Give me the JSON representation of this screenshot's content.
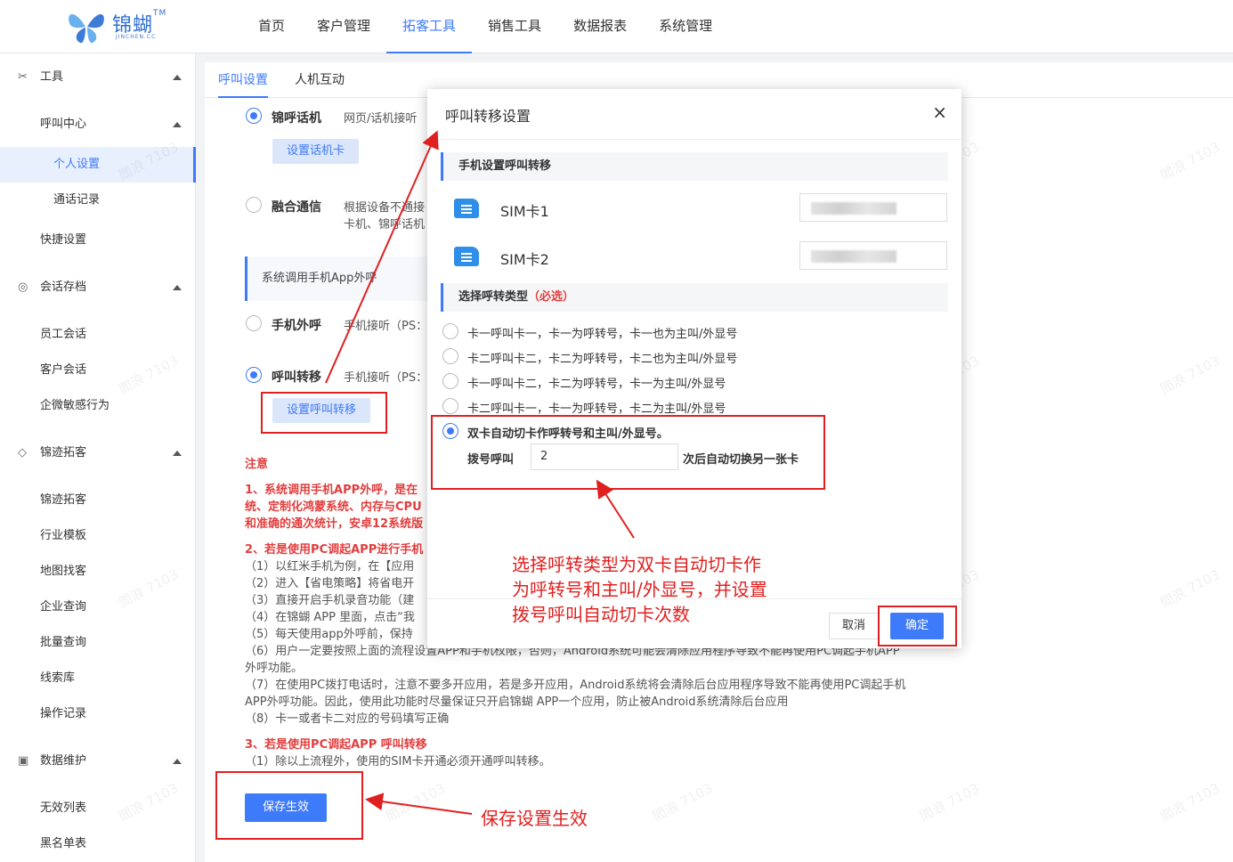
{
  "app": {
    "logo_text": "锦蝴",
    "logo_sub": "JINCHEN.CC",
    "nav": [
      "首页",
      "客户管理",
      "拓客工具",
      "销售工具",
      "数据报表",
      "系统管理"
    ],
    "nav_active": "拓客工具"
  },
  "sidebar": {
    "tools": "工具",
    "call_center": "呼叫中心",
    "personal_settings": "个人设置",
    "call_records": "通话记录",
    "quick_settings": "快捷设置",
    "session_archive": "会话存档",
    "employee_session": "员工会话",
    "customer_session": "客户会话",
    "wechat_sensitive": "企微敏感行为",
    "jinji_tuoke": "锦迹拓客",
    "jinji_tuoke_item": "锦迹拓客",
    "industry_template": "行业模板",
    "map_find": "地图找客",
    "company_query": "企业查询",
    "batch_query": "批量查询",
    "lead_library": "线索库",
    "operation_log": "操作记录",
    "data_maintain": "数据维护",
    "invalid_list": "无效列表",
    "blacklist": "黑名单表"
  },
  "tabs": [
    "呼叫设置",
    "人机互动"
  ],
  "options": {
    "jinhu_title": "锦呼话机",
    "jinhu_desc": "网页/话机接听",
    "jinhu_btn": "设置话机卡",
    "ronghe_title": "融合通信",
    "ronghe_desc1": "根据设备不通接",
    "ronghe_desc2": "卡机、锦呼话机",
    "hint": "系统调用手机App外呼",
    "phone_title": "手机外呼",
    "phone_desc": "手机接听（PS：",
    "transfer_title": "呼叫转移",
    "transfer_desc": "手机接听（PS：",
    "transfer_btn": "设置呼叫转移"
  },
  "notes": {
    "title": "注意",
    "n1a": "1、系统调用手机APP外呼，是在",
    "n1b": "统、定制化鸿蒙系统、内存与CPU",
    "n1c": "和准确的通次统计，安卓12系统版",
    "n2": "2、若是使用PC调起APP进行手机",
    "n2_1": "（1）以红米手机为例，在【应用",
    "n2_2": "（2）进入【省电策略】将省电开",
    "n2_3": "（3）直接开启手机录音功能（建",
    "n2_4": "（4）在锦蝴 APP 里面，点击“我",
    "n2_5": "（5）每天使用app外呼前，保持",
    "n2_6": "（6）用户一定要按照上面的流程设置APP和手机权限，否则，Android系统可能会清除应用程序导致不能再使用PC调起手机APP",
    "n2_6b": "外呼功能。",
    "n2_7": "（7）在使用PC拨打电话时，注意不要多开应用，若是多开应用，Android系统将会清除后台应用程序导致不能再使用PC调起手机",
    "n2_7b": "APP外呼功能。因此，使用此功能时尽量保证只开启锦蝴 APP一个应用，防止被Android系统清除后台应用",
    "n2_8": "（8）卡一或者卡二对应的号码填写正确",
    "n3": "3、若是使用PC调起APP 呼叫转移",
    "n3_1": "（1）除以上流程外，使用的SIM卡开通必须开通呼叫转移。"
  },
  "save_btn": "保存生效",
  "modal": {
    "title": "呼叫转移设置",
    "close": "×",
    "section1": "手机设置呼叫转移",
    "sim1": "SIM卡1",
    "sim2": "SIM卡2",
    "section2": "选择呼转类型",
    "section2_req": "（必选）",
    "radios": [
      "卡一呼叫卡一，卡一为呼转号，卡一也为主叫/外显号",
      "卡二呼叫卡二，卡二为呼转号，卡二也为主叫/外显号",
      "卡一呼叫卡二，卡二为呼转号，卡一为主叫/外显号",
      "卡二呼叫卡一，卡一为呼转号，卡二为主叫/外显号"
    ],
    "auto_radio": "双卡自动切卡作呼转号和主叫/外显号。",
    "dial_label": "拨号呼叫",
    "dial_value": "2",
    "dial_suffix": "次后自动切换另一张卡",
    "cancel": "取消",
    "confirm": "确定"
  },
  "annotations": {
    "note1_line1": "选择呼转类型为双卡自动切卡作",
    "note1_line2": "为呼转号和主叫/外显号，并设置",
    "note1_line3": "拨号呼叫自动切卡次数",
    "note2": "保存设置生效"
  },
  "watermark": "閻浪 7103",
  "colors": {
    "accent": "#3e7bfa",
    "annotation": "#e02020"
  }
}
